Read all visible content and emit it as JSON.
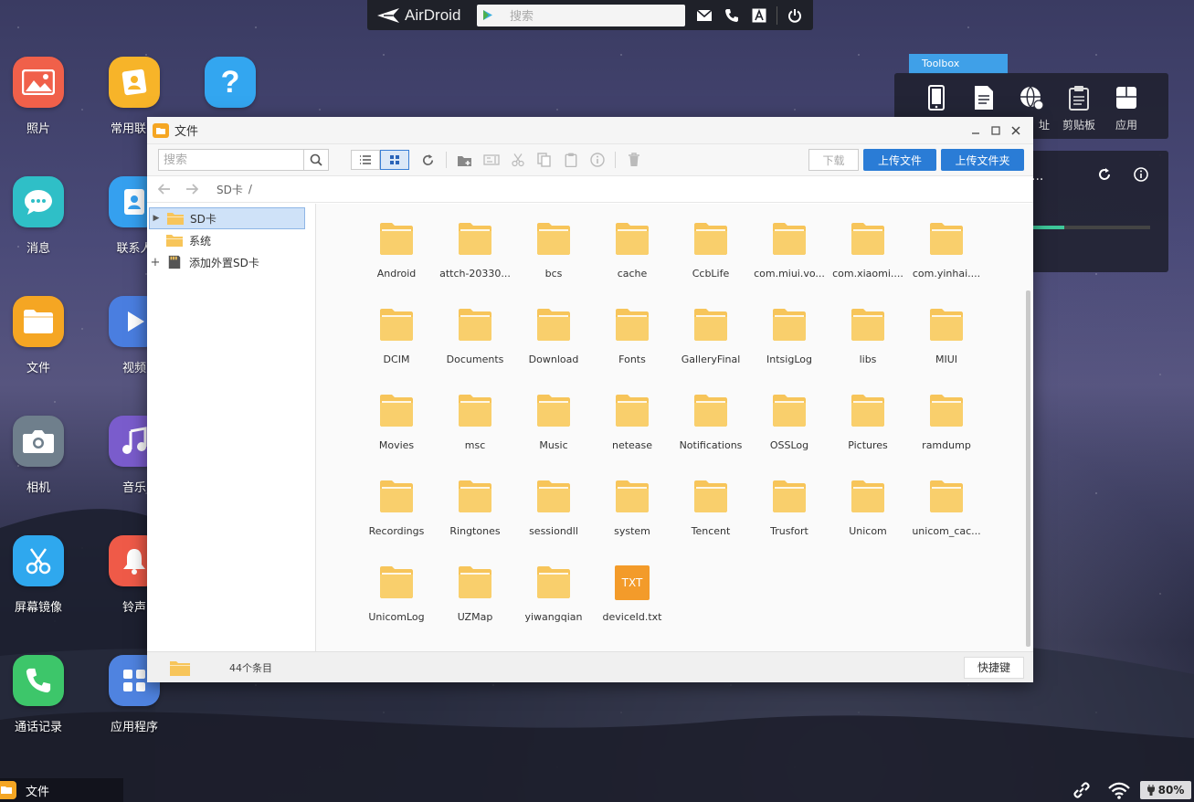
{
  "topbar": {
    "app_name": "AirDroid",
    "search_placeholder": "搜索"
  },
  "desktop": {
    "icons": [
      {
        "label": "照片"
      },
      {
        "label": "常用联系"
      },
      {
        "label": "消息"
      },
      {
        "label": "联系人"
      },
      {
        "label": "文件"
      },
      {
        "label": "视频"
      },
      {
        "label": "相机"
      },
      {
        "label": "音乐"
      },
      {
        "label": "屏幕镜像"
      },
      {
        "label": "铃声"
      },
      {
        "label": "通话记录"
      },
      {
        "label": "应用程序"
      }
    ]
  },
  "toolbox": {
    "tab_label": "Toolbox",
    "items": [
      {
        "label": "",
        "icon": "phone-icon"
      },
      {
        "label": "",
        "icon": "document-icon"
      },
      {
        "label": "址",
        "icon": "globe-icon"
      },
      {
        "label": "剪贴板",
        "icon": "clipboard-icon"
      },
      {
        "label": "应用",
        "icon": "apps-icon"
      }
    ],
    "widget_text": "..."
  },
  "file_window": {
    "title": "文件",
    "search_placeholder": "搜索",
    "download_label": "下载",
    "upload_file_label": "上传文件",
    "upload_folder_label": "上传文件夹",
    "path_label": "SD卡",
    "path_sep": "/",
    "tree": [
      {
        "label": "SD卡",
        "selected": true,
        "toggle": "▶"
      },
      {
        "label": "系统",
        "selected": false,
        "toggle": ""
      },
      {
        "label": "添加外置SD卡",
        "selected": false,
        "toggle": "+"
      }
    ],
    "files": [
      {
        "name": "Android",
        "type": "folder"
      },
      {
        "name": "attch-20330...",
        "type": "folder"
      },
      {
        "name": "bcs",
        "type": "folder"
      },
      {
        "name": "cache",
        "type": "folder"
      },
      {
        "name": "CcbLife",
        "type": "folder"
      },
      {
        "name": "com.miui.vo...",
        "type": "folder"
      },
      {
        "name": "com.xiaomi....",
        "type": "folder"
      },
      {
        "name": "com.yinhai....",
        "type": "folder"
      },
      {
        "name": "DCIM",
        "type": "folder"
      },
      {
        "name": "Documents",
        "type": "folder"
      },
      {
        "name": "Download",
        "type": "folder"
      },
      {
        "name": "Fonts",
        "type": "folder"
      },
      {
        "name": "GalleryFinal",
        "type": "folder"
      },
      {
        "name": "IntsigLog",
        "type": "folder"
      },
      {
        "name": "libs",
        "type": "folder"
      },
      {
        "name": "MIUI",
        "type": "folder"
      },
      {
        "name": "Movies",
        "type": "folder"
      },
      {
        "name": "msc",
        "type": "folder"
      },
      {
        "name": "Music",
        "type": "folder"
      },
      {
        "name": "netease",
        "type": "folder"
      },
      {
        "name": "Notifications",
        "type": "folder"
      },
      {
        "name": "OSSLog",
        "type": "folder"
      },
      {
        "name": "Pictures",
        "type": "folder"
      },
      {
        "name": "ramdump",
        "type": "folder"
      },
      {
        "name": "Recordings",
        "type": "folder"
      },
      {
        "name": "Ringtones",
        "type": "folder"
      },
      {
        "name": "sessiondll",
        "type": "folder"
      },
      {
        "name": "system",
        "type": "folder"
      },
      {
        "name": "Tencent",
        "type": "folder"
      },
      {
        "name": "Trusfort",
        "type": "folder"
      },
      {
        "name": "Unicom",
        "type": "folder"
      },
      {
        "name": "unicom_cac...",
        "type": "folder"
      },
      {
        "name": "UnicomLog",
        "type": "folder"
      },
      {
        "name": "UZMap",
        "type": "folder"
      },
      {
        "name": "yiwangqian",
        "type": "folder"
      },
      {
        "name": "deviceId.txt",
        "type": "txt",
        "badge": "TXT"
      }
    ],
    "status_count": "44个条目",
    "shortcut_label": "快捷键"
  },
  "taskbar": {
    "app_label": "文件",
    "battery": "80%"
  },
  "colors": {
    "folder": "#f7c55a",
    "accent": "#2a7cd6",
    "toolbox_tab": "#3fa0e8"
  }
}
